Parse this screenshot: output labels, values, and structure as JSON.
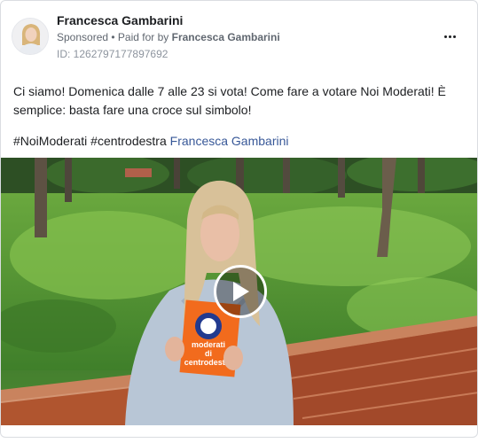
{
  "post": {
    "author": "Francesca Gambarini",
    "sponsored_label": "Sponsored",
    "separator": " • ",
    "paid_for_label": "Paid for by ",
    "paid_for_name": "Francesca Gambarini",
    "ad_id": "ID: 1262797177897692",
    "message": "Ci siamo! Domenica dalle 7 alle 23 si vota! Come fare a votare Noi Moderati! È semplice: basta fare una croce sul simbolo!",
    "hashtags": "#NoiModerati #centrodestra ",
    "mention": "Francesca Gambarini"
  },
  "media": {
    "book_text_line1": "moderati",
    "book_text_line2": "di",
    "book_text_line3": "centrodestra"
  },
  "colors": {
    "link": "#385898",
    "muted": "#606770",
    "book": "#f26b1d"
  }
}
